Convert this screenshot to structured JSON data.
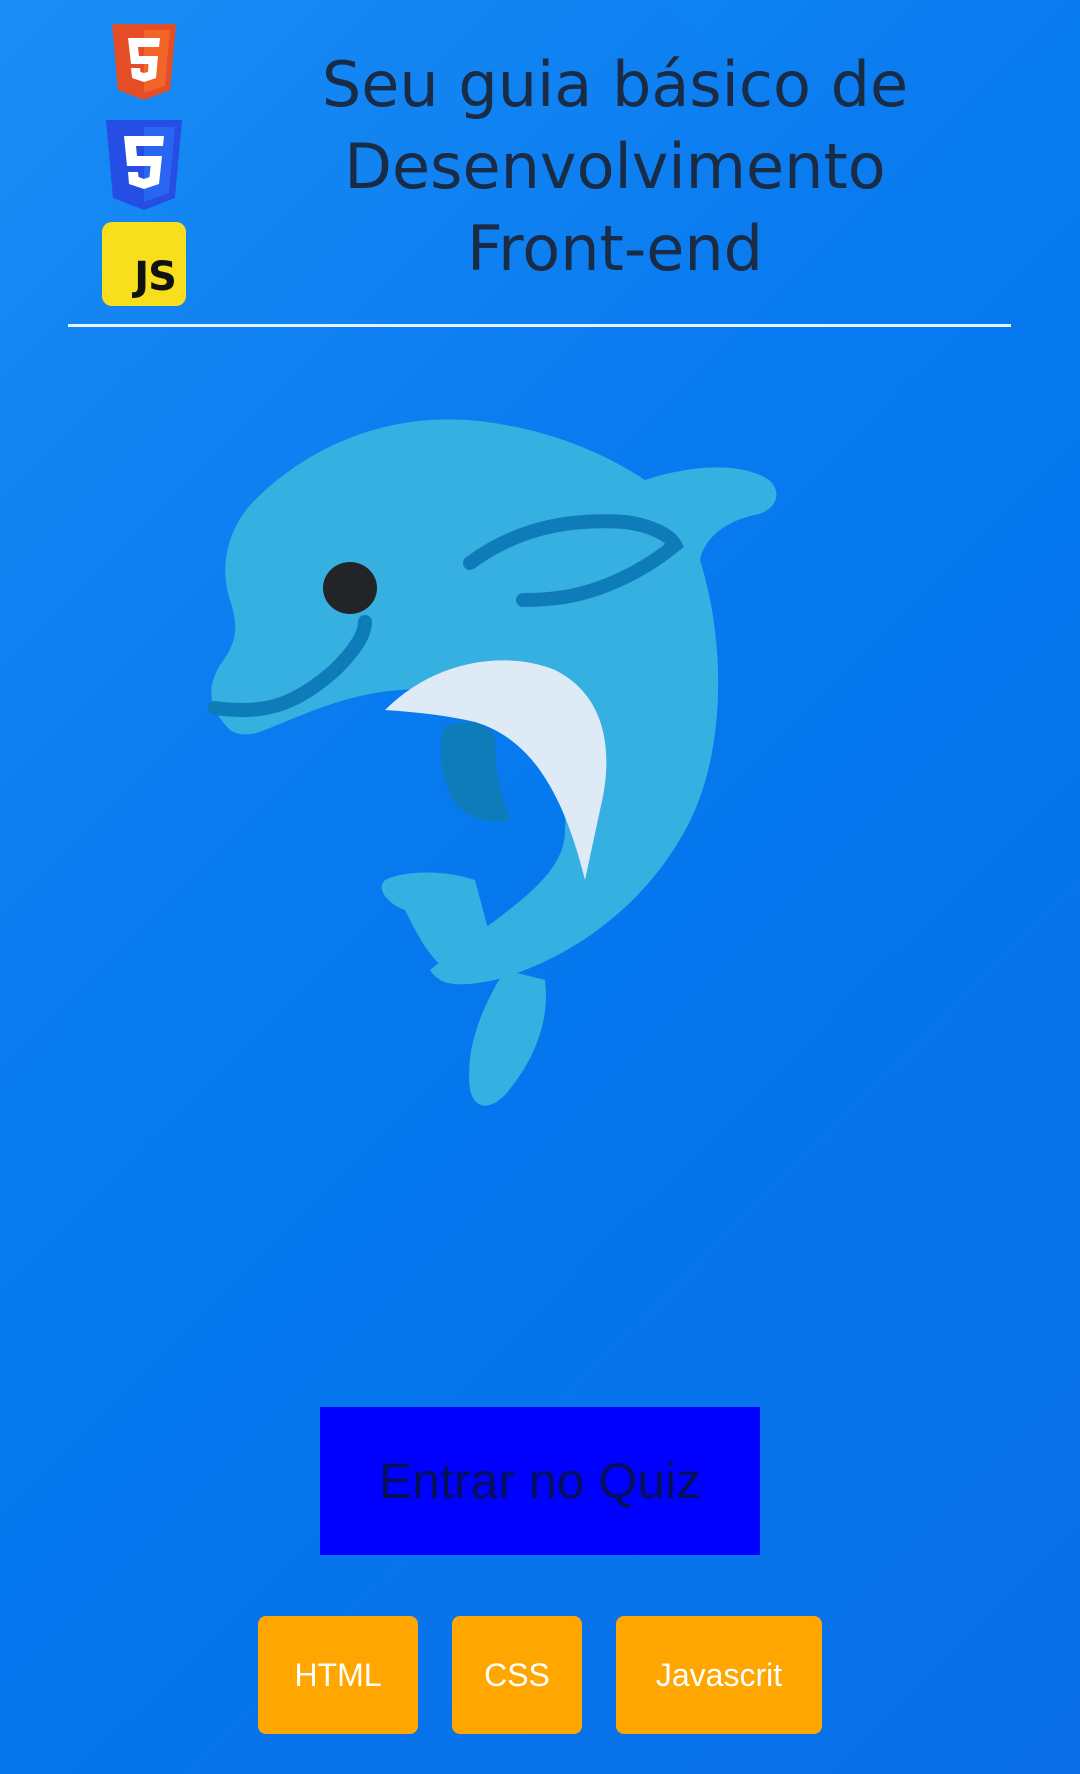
{
  "header": {
    "title_lines": [
      "Seu guia básico de",
      "Desenvolvimento",
      "Front-end"
    ],
    "logos": [
      {
        "icon": "html5-icon",
        "color": "#e44d26"
      },
      {
        "icon": "css3-icon",
        "color": "#264de4"
      },
      {
        "icon": "javascript-icon",
        "label": "JS",
        "color": "#f7df1e"
      }
    ]
  },
  "hero": {
    "icon": "dolphin-icon"
  },
  "actions": {
    "quiz_label": "Entrar no Quiz"
  },
  "topics": [
    {
      "label": "HTML"
    },
    {
      "label": "CSS"
    },
    {
      "label": "Javascrit"
    }
  ],
  "colors": {
    "background": "#0a7cf0",
    "title_text": "#1a2b45",
    "quiz_button": "#0000ff",
    "topic_button": "#ffa600",
    "dolphin_body": "#35b0e0"
  }
}
